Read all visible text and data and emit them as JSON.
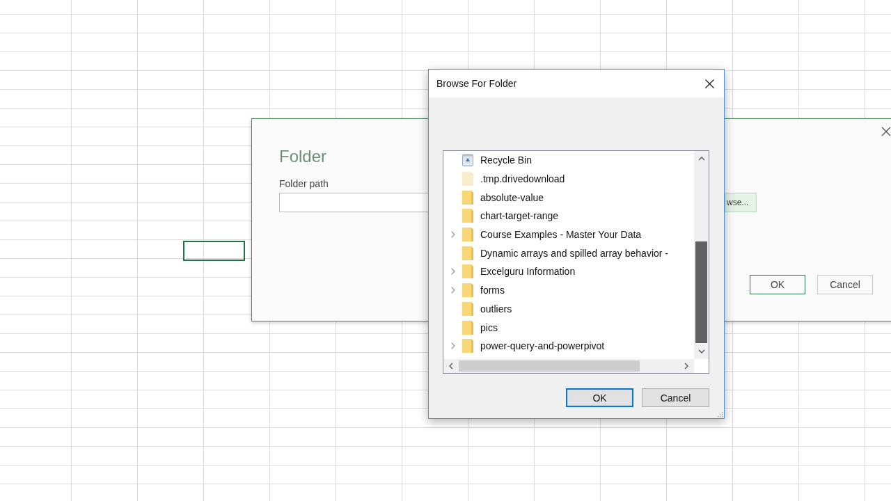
{
  "folder_dialog": {
    "title": "Folder",
    "path_label": "Folder path",
    "browse_button": "wse...",
    "buttons": [
      {
        "label": "OK",
        "default": true
      },
      {
        "label": "Cancel",
        "default": false
      }
    ]
  },
  "browse_dialog": {
    "title": "Browse For Folder",
    "items": [
      {
        "name": "Recycle Bin",
        "kind": "recycle-bin",
        "expandable": false
      },
      {
        "name": ".tmp.drivedownload",
        "kind": "hidden-folder",
        "expandable": false
      },
      {
        "name": "absolute-value",
        "kind": "folder",
        "expandable": false
      },
      {
        "name": "chart-target-range",
        "kind": "folder",
        "expandable": false
      },
      {
        "name": "Course Examples - Master Your Data",
        "kind": "folder",
        "expandable": true
      },
      {
        "name": "Dynamic arrays and spilled array behavior -",
        "kind": "folder",
        "expandable": false
      },
      {
        "name": "Excelguru Information",
        "kind": "folder",
        "expandable": true
      },
      {
        "name": "forms",
        "kind": "folder",
        "expandable": true
      },
      {
        "name": "outliers",
        "kind": "folder",
        "expandable": false
      },
      {
        "name": "pics",
        "kind": "folder",
        "expandable": false
      },
      {
        "name": "power-query-and-powerpivot",
        "kind": "folder",
        "expandable": true
      }
    ],
    "buttons": [
      {
        "label": "OK",
        "default": true
      },
      {
        "label": "Cancel",
        "default": false
      }
    ]
  }
}
